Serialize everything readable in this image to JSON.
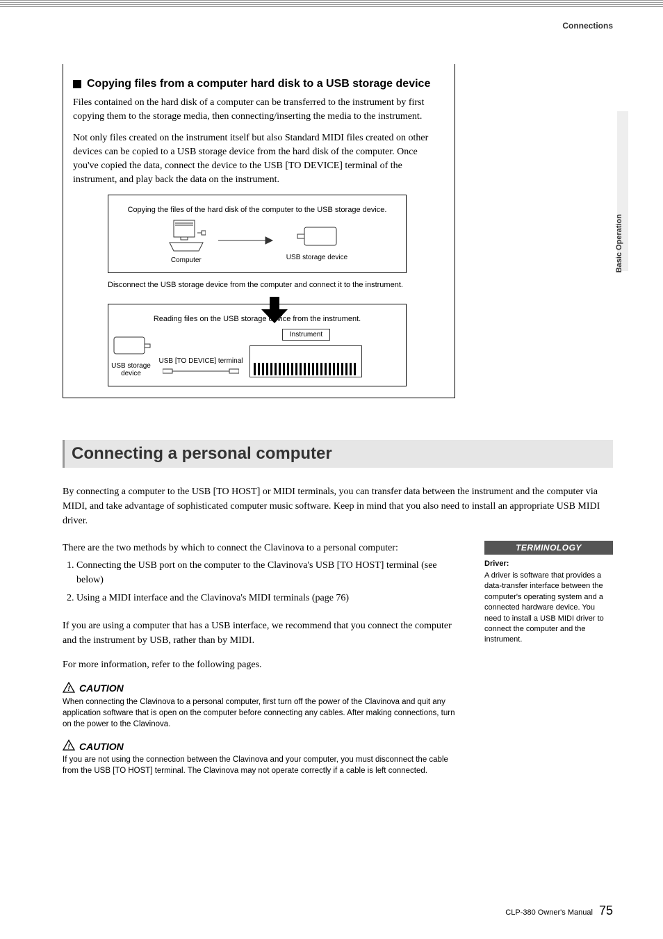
{
  "header": {
    "breadcrumb": "Connections"
  },
  "side_tab": "Basic Operation",
  "boxed": {
    "title": "Copying files from a computer hard disk to a USB storage device",
    "para1": "Files contained on the hard disk of a computer can be transferred to the instrument by first copying them to the storage media, then connecting/inserting the media to the instrument.",
    "para2": "Not only files created on the instrument itself but also Standard MIDI files created on other devices can be copied to a USB storage device from the hard disk of the computer. Once you've copied the data, connect the device to the USB [TO DEVICE] terminal of the instrument, and play back the data on the instrument."
  },
  "diagram": {
    "top_caption": "Copying the files of the hard disk of the computer to the USB storage device.",
    "computer_label": "Computer",
    "usb_label": "USB storage device",
    "mid_text": "Disconnect the USB storage device from the computer and connect it to the instrument.",
    "bottom_caption": "Reading files on the USB storage device from the instrument.",
    "usb_terminal_label": "USB [TO DEVICE] terminal",
    "usb_storage_short": "USB storage device",
    "instrument_label": "Instrument"
  },
  "section": {
    "title": "Connecting a personal computer",
    "intro": "By connecting a computer to the USB [TO HOST] or MIDI terminals, you can transfer data between the instrument and the computer via MIDI, and take advantage of sophisticated computer music software. Keep in mind that you also need to install an appropriate USB MIDI driver.",
    "methods_intro": "There are the two methods by which to connect the Clavinova to a personal computer:",
    "methods": [
      "Connecting the USB port on the computer to the Clavinova's USB [TO HOST] terminal (see below)",
      "Using a MIDI interface and the Clavinova's MIDI terminals (page 76)"
    ],
    "usb_note": "If you are using a computer that has a USB interface, we recommend that you connect the computer and the instrument by USB, rather than by MIDI.",
    "more_info": "For more information, refer to the following pages."
  },
  "terminology": {
    "header": "TERMINOLOGY",
    "term": "Driver:",
    "body": "A driver is software that provides a data-transfer interface between the computer's operating system and a connected hardware device. You need to install a USB MIDI driver to connect the computer and the instrument."
  },
  "cautions": [
    {
      "label": "CAUTION",
      "body": "When connecting the Clavinova to a personal computer, first turn off the power of the Clavinova and quit any application software that is open on the computer before connecting any cables. After making connections, turn on the power to the Clavinova."
    },
    {
      "label": "CAUTION",
      "body": "If you are not using the connection between the Clavinova and your computer, you must disconnect the cable from the USB [TO HOST] terminal. The Clavinova may not operate correctly if a cable is left connected."
    }
  ],
  "footer": {
    "manual": "CLP-380 Owner's Manual",
    "page": "75"
  }
}
